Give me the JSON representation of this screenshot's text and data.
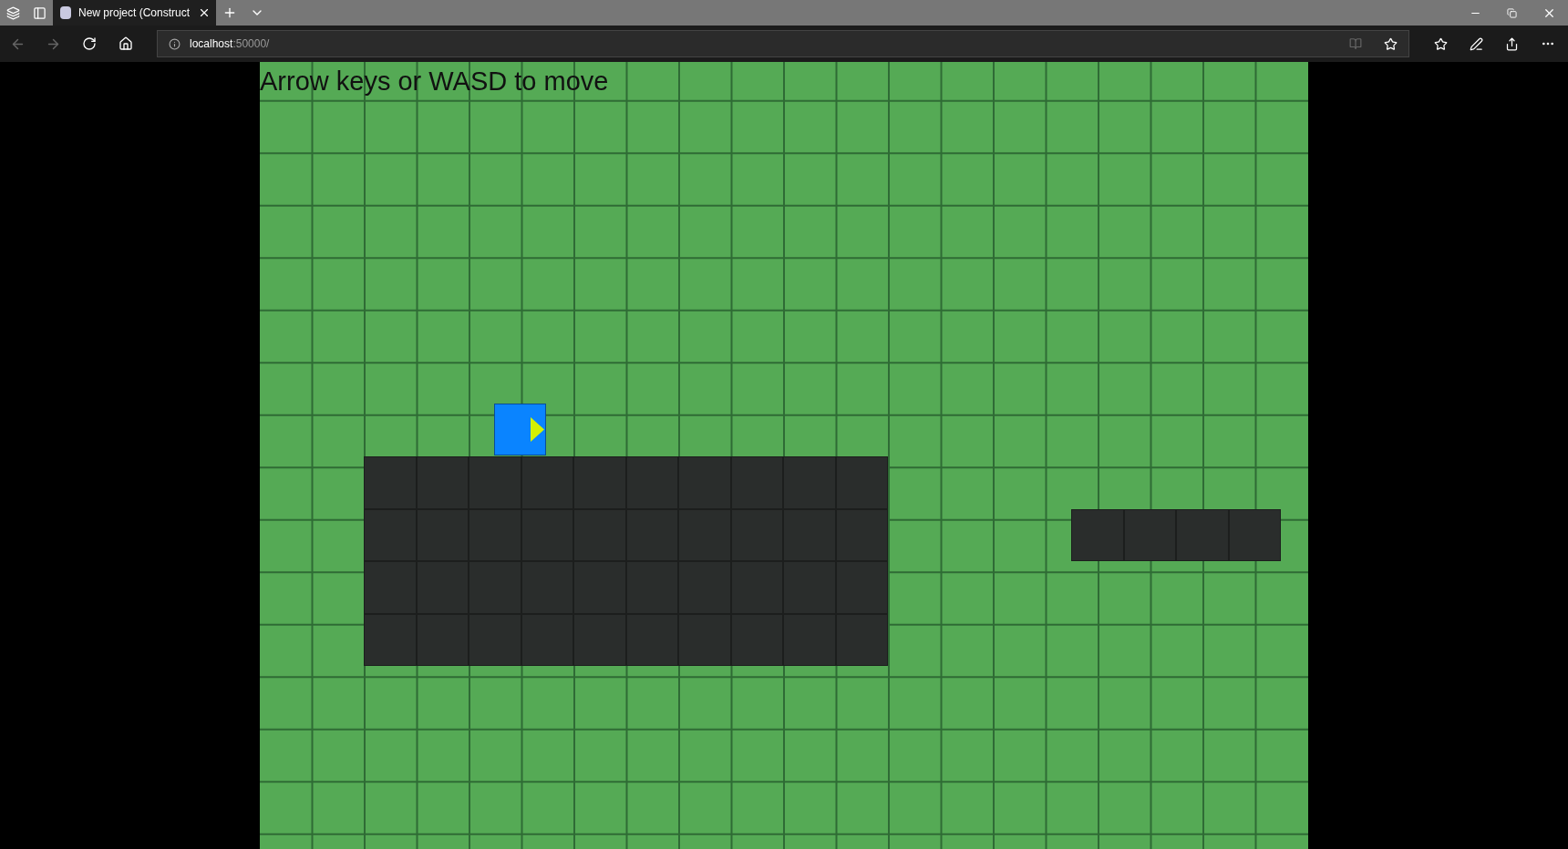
{
  "tab_bar": {
    "tabs": [
      {
        "title": "New project (Construct",
        "selected": true
      }
    ]
  },
  "address_bar": {
    "url_host": "localhost",
    "url_rest": ":50000/"
  },
  "game": {
    "hint": "Arrow keys or WASD to move"
  }
}
